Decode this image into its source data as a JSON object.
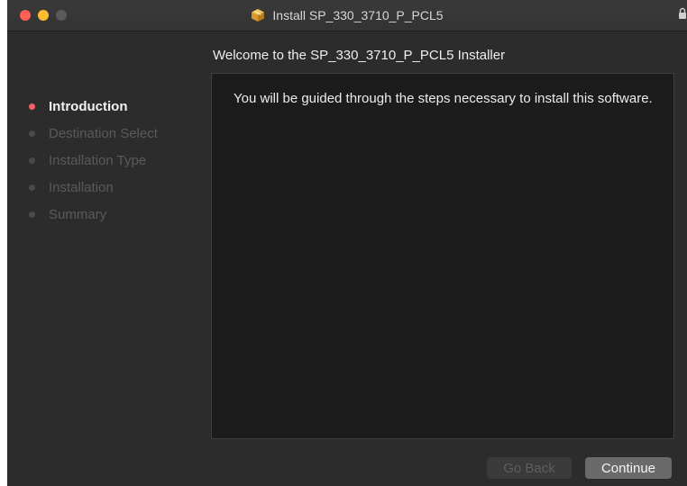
{
  "window": {
    "title": "Install SP_330_3710_P_PCL5",
    "title_icon": "package-icon",
    "lock_icon": "lock-icon"
  },
  "header": {
    "title": "Welcome to the SP_330_3710_P_PCL5 Installer"
  },
  "sidebar": {
    "steps": [
      {
        "label": "Introduction",
        "active": true
      },
      {
        "label": "Destination Select",
        "active": false
      },
      {
        "label": "Installation Type",
        "active": false
      },
      {
        "label": "Installation",
        "active": false
      },
      {
        "label": "Summary",
        "active": false
      }
    ]
  },
  "main": {
    "text": "You will be guided through the steps necessary to install this software."
  },
  "buttons": {
    "back_label": "Go Back",
    "continue_label": "Continue"
  },
  "colors": {
    "window_bg": "#2c2c2c",
    "content_bg": "#1c1c1c",
    "active_dot": "#f4616a",
    "close": "#fe5f57",
    "minimize": "#febc2e"
  }
}
